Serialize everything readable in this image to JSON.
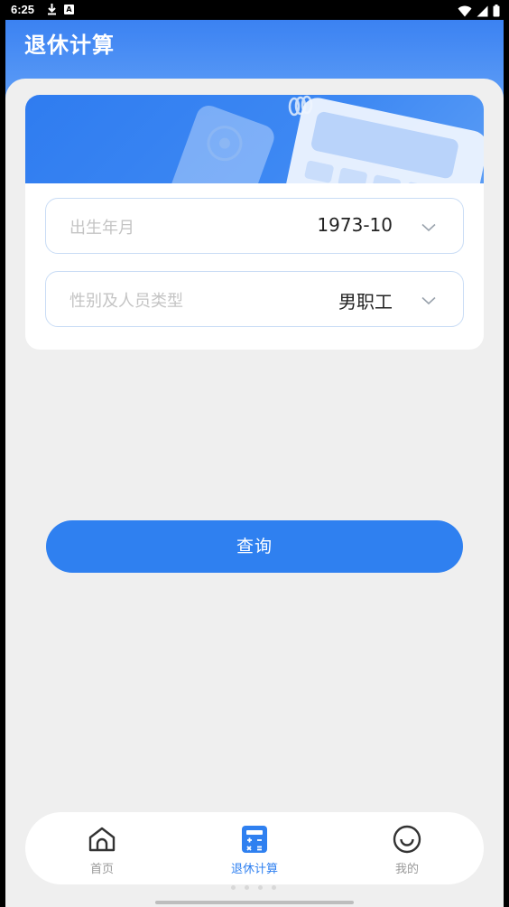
{
  "status_bar": {
    "time": "6:25",
    "download_icon": "download-icon",
    "notification_badge": "A",
    "right_icons": [
      "wifi-icon",
      "signal-icon",
      "battery-icon"
    ]
  },
  "header": {
    "title": "退休计算"
  },
  "form": {
    "birth": {
      "label": "出生年月",
      "value": "1973-10"
    },
    "gender_type": {
      "label": "性别及人员类型",
      "value": "男职工"
    }
  },
  "query_button": {
    "label": "查询"
  },
  "tabbar": {
    "items": [
      {
        "label": "首页",
        "icon": "home-icon",
        "active": false
      },
      {
        "label": "退休计算",
        "icon": "calculator-icon",
        "active": true
      },
      {
        "label": "我的",
        "icon": "smile-icon",
        "active": false
      }
    ]
  },
  "colors": {
    "primary": "#2f80f0",
    "header_gradient_top": "#3b82f2",
    "inactive_tab": "#999999",
    "field_border": "#c9dcf5",
    "background": "#efefef"
  }
}
